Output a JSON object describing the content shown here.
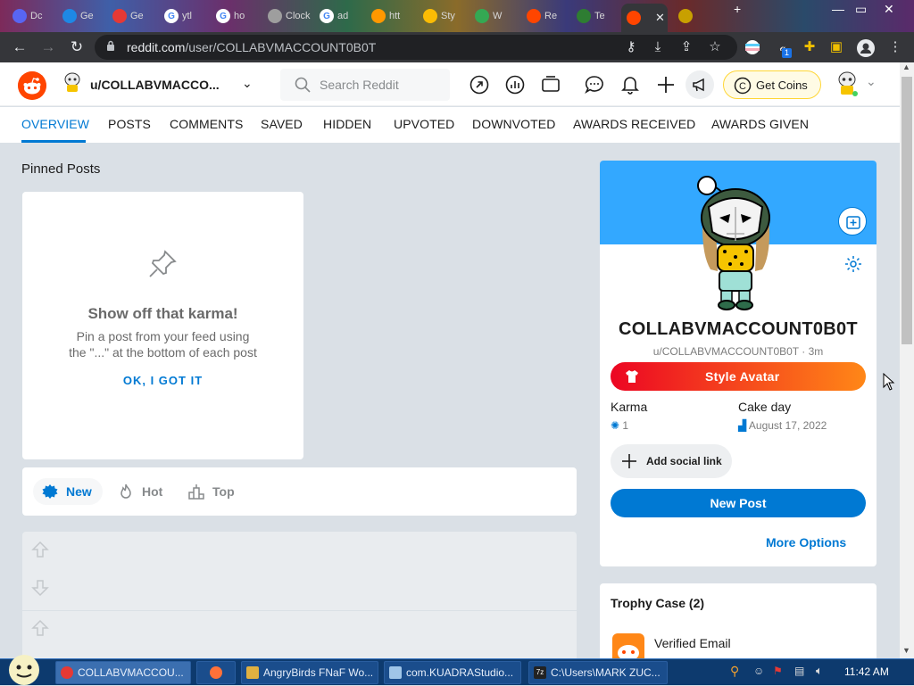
{
  "browser": {
    "tabs": [
      {
        "label": "Dc",
        "icon": "discord-icon",
        "color": "#5865f2"
      },
      {
        "label": "Ge",
        "icon": "windows-icon",
        "color": "#1e88e5"
      },
      {
        "label": "Ge",
        "icon": "chrome-icon",
        "color": "#e53935"
      },
      {
        "label": "ytl",
        "icon": "google-icon",
        "color": "#4285f4"
      },
      {
        "label": "ho",
        "icon": "google-icon",
        "color": "#4285f4"
      },
      {
        "label": "Clock E",
        "icon": "page-icon",
        "color": "#9e9e9e"
      },
      {
        "label": "ad",
        "icon": "google-icon",
        "color": "#4285f4"
      },
      {
        "label": "htt",
        "icon": "colorful-icon",
        "color": "#ff9800"
      },
      {
        "label": "Sty",
        "icon": "chrome-icon",
        "color": "#fbbc04"
      },
      {
        "label": "W",
        "icon": "colorful-icon",
        "color": "#34a853"
      },
      {
        "label": "Re",
        "icon": "reddit-icon",
        "color": "#ff4500"
      },
      {
        "label": "Te",
        "icon": "teams-icon",
        "color": "#2e7d32"
      },
      {
        "label": "",
        "icon": "reddit-icon",
        "color": "#ff4500"
      },
      {
        "label": "",
        "icon": "puzzle-icon",
        "color": "#c8a000"
      }
    ],
    "url_domain": "reddit.com",
    "url_path": "/user/COLLABVMACCOUNT0B0T",
    "ext_badge": "1"
  },
  "header": {
    "username_short": "u/COLLABVMACCO...",
    "search_placeholder": "Search Reddit",
    "coins_label": "Get Coins"
  },
  "nav": {
    "tabs": [
      "OVERVIEW",
      "POSTS",
      "COMMENTS",
      "SAVED",
      "HIDDEN",
      "UPVOTED",
      "DOWNVOTED",
      "AWARDS RECEIVED",
      "AWARDS GIVEN"
    ]
  },
  "pinned": {
    "title": "Pinned Posts",
    "heading": "Show off that karma!",
    "desc_line1": "Pin a post from your feed using",
    "desc_line2": "the \"...\" at the bottom of each post",
    "action": "OK, I GOT IT"
  },
  "sort": {
    "new": "New",
    "hot": "Hot",
    "top": "Top"
  },
  "profile": {
    "display_name": "COLLABVMACCOUNT0B0T",
    "handle": "u/COLLABVMACCOUNT0B0T · 3m",
    "style_avatar": "Style Avatar",
    "karma_label": "Karma",
    "karma_value": "1",
    "cakeday_label": "Cake day",
    "cakeday_value": "August 17, 2022",
    "social_link": "Add social link",
    "new_post": "New Post",
    "more_options": "More Options"
  },
  "trophy": {
    "title": "Trophy Case (2)",
    "item": "Verified Email"
  },
  "taskbar": {
    "tasks": [
      "COLLABVMACCOU...",
      "",
      "AngryBirds FNaF Wo...",
      "com.KUADRAStudio...",
      "C:\\Users\\MARK ZUC..."
    ],
    "clock": "11:42 AM"
  },
  "colors": {
    "reddit_orange": "#ff4500",
    "reddit_blue": "#0079d3",
    "banner_blue": "#33a8ff"
  }
}
